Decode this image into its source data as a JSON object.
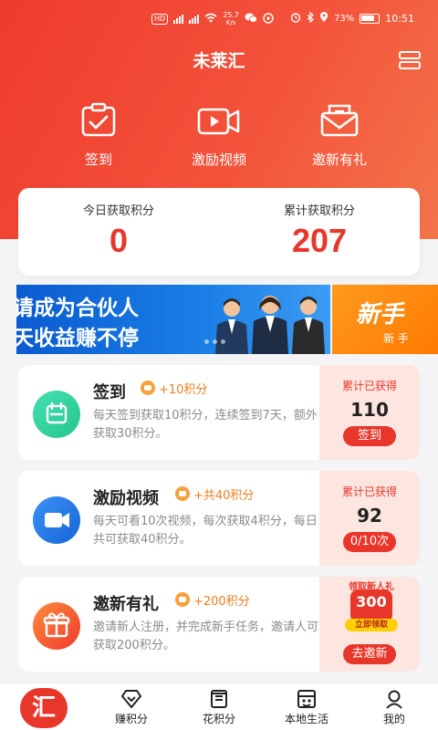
{
  "status_bar": {
    "net_badge": "HD",
    "speed": "25.7",
    "speed_unit": "K/s",
    "battery": "73%",
    "time": "10:51",
    "icons": [
      "signal-icon",
      "wifi-icon",
      "wechat-icon",
      "alarm-icon",
      "bluetooth-icon",
      "location-icon",
      "battery-icon"
    ]
  },
  "header": {
    "title": "未莱汇",
    "menu_icon": "menu-icon"
  },
  "quick_actions": [
    {
      "label": "签到",
      "icon": "clipboard-check-icon"
    },
    {
      "label": "激励视频",
      "icon": "video-camera-icon"
    },
    {
      "label": "邀新有礼",
      "icon": "envelope-icon"
    }
  ],
  "score": {
    "today_label": "今日获取积分",
    "today_value": "0",
    "total_label": "累计获取积分",
    "total_value": "207"
  },
  "banners": [
    {
      "line1": "请成为合伙人",
      "line2": "天收益赚不停"
    },
    {
      "title": "新手",
      "subtitle": "新 手"
    }
  ],
  "tasks": [
    {
      "name": "签到",
      "points": "+10积分",
      "desc": "每天签到获取10积分，连续签到7天，额外获取30积分。",
      "side_label": "累计已获得",
      "side_value": "110",
      "button": "签到",
      "icon": "calendar-icon",
      "icon_color": "#34d3a3"
    },
    {
      "name": "激励视频",
      "points": "+共40积分",
      "desc": "每天可看10次视频，每次获取4积分，每日共可获取40积分。",
      "side_label": "累计已获得",
      "side_value": "92",
      "button": "0/10次",
      "icon": "video-icon",
      "icon_color": "#1f7be8"
    },
    {
      "name": "邀新有礼",
      "points": "+200积分",
      "desc": "邀请新人注册，并完成新手任务，邀请人可获取200积分。",
      "promo_top": "领取新人礼",
      "promo_mid": "300",
      "promo_bottom": "立即领取",
      "button": "去邀新",
      "icon": "gift-icon",
      "icon_color": "#f5572e"
    }
  ],
  "tabbar": {
    "logo": "汇",
    "items": [
      {
        "label": "赚积分",
        "icon": "diamond-icon"
      },
      {
        "label": "花积分",
        "icon": "receipt-icon"
      },
      {
        "label": "本地生活",
        "icon": "store-icon"
      },
      {
        "label": "我的",
        "icon": "user-icon"
      }
    ]
  },
  "colors": {
    "primary": "#e8372a",
    "accent": "#ef7c1f",
    "hero_end": "#f3754a"
  }
}
